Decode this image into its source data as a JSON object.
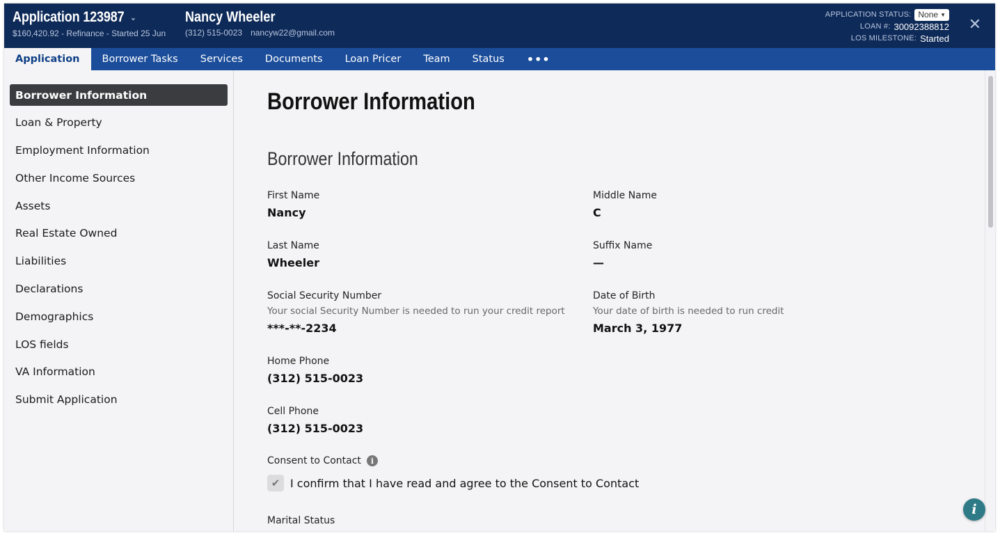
{
  "header": {
    "app_title": "Application 123987",
    "app_subtitle": "$160,420.92 - Refinance - Started 25 Jun",
    "borrower_name": "Nancy Wheeler",
    "borrower_phone": "(312) 515-0023",
    "borrower_email": "nancyw22@gmail.com",
    "application_status_label": "APPLICATION STATUS:",
    "application_status_value": "None",
    "loan_label": "LOAN #:",
    "loan_value": "30092388812",
    "milestone_label": "LOS MILESTONE:",
    "milestone_value": "Started",
    "close_icon": "close-icon"
  },
  "tabs": [
    {
      "label": "Application",
      "active": true
    },
    {
      "label": "Borrower Tasks"
    },
    {
      "label": "Services"
    },
    {
      "label": "Documents"
    },
    {
      "label": "Loan Pricer"
    },
    {
      "label": "Team"
    },
    {
      "label": "Status"
    },
    {
      "label": "•••"
    }
  ],
  "sidebar": {
    "items": [
      {
        "label": "Borrower Information",
        "active": true
      },
      {
        "label": "Loan & Property"
      },
      {
        "label": "Employment Information"
      },
      {
        "label": "Other Income Sources"
      },
      {
        "label": "Assets"
      },
      {
        "label": "Real Estate Owned"
      },
      {
        "label": "Liabilities"
      },
      {
        "label": "Declarations"
      },
      {
        "label": "Demographics"
      },
      {
        "label": "LOS fields"
      },
      {
        "label": "VA Information"
      },
      {
        "label": "Submit Application"
      }
    ]
  },
  "content": {
    "page_title": "Borrower Information",
    "section_title": "Borrower Information",
    "fields": {
      "first_name": {
        "label": "First Name",
        "value": "Nancy"
      },
      "middle_name": {
        "label": "Middle Name",
        "value": "C"
      },
      "last_name": {
        "label": "Last Name",
        "value": "Wheeler"
      },
      "suffix_name": {
        "label": "Suffix Name",
        "value": "—"
      },
      "ssn": {
        "label": "Social Security Number",
        "help": "Your social Security Number is needed to run your credit report",
        "value": "***-**-2234"
      },
      "dob": {
        "label": "Date of Birth",
        "help": "Your date of birth is needed to run credit",
        "value": "March 3, 1977"
      },
      "home_phone": {
        "label": "Home Phone",
        "value": "(312) 515-0023"
      },
      "cell_phone": {
        "label": "Cell Phone",
        "value": "(312) 515-0023"
      }
    },
    "consent": {
      "label": "Consent to Contact",
      "checkbox_text": "I confirm that I have read and agree to the Consent to Contact",
      "checked": true
    },
    "marital_status_label": "Marital Status"
  },
  "colors": {
    "header_bg": "#0e2a58",
    "tabs_bg": "#1b4d9a",
    "sidebar_active_bg": "#3a3c40",
    "help_fab": "#2e7a86"
  }
}
